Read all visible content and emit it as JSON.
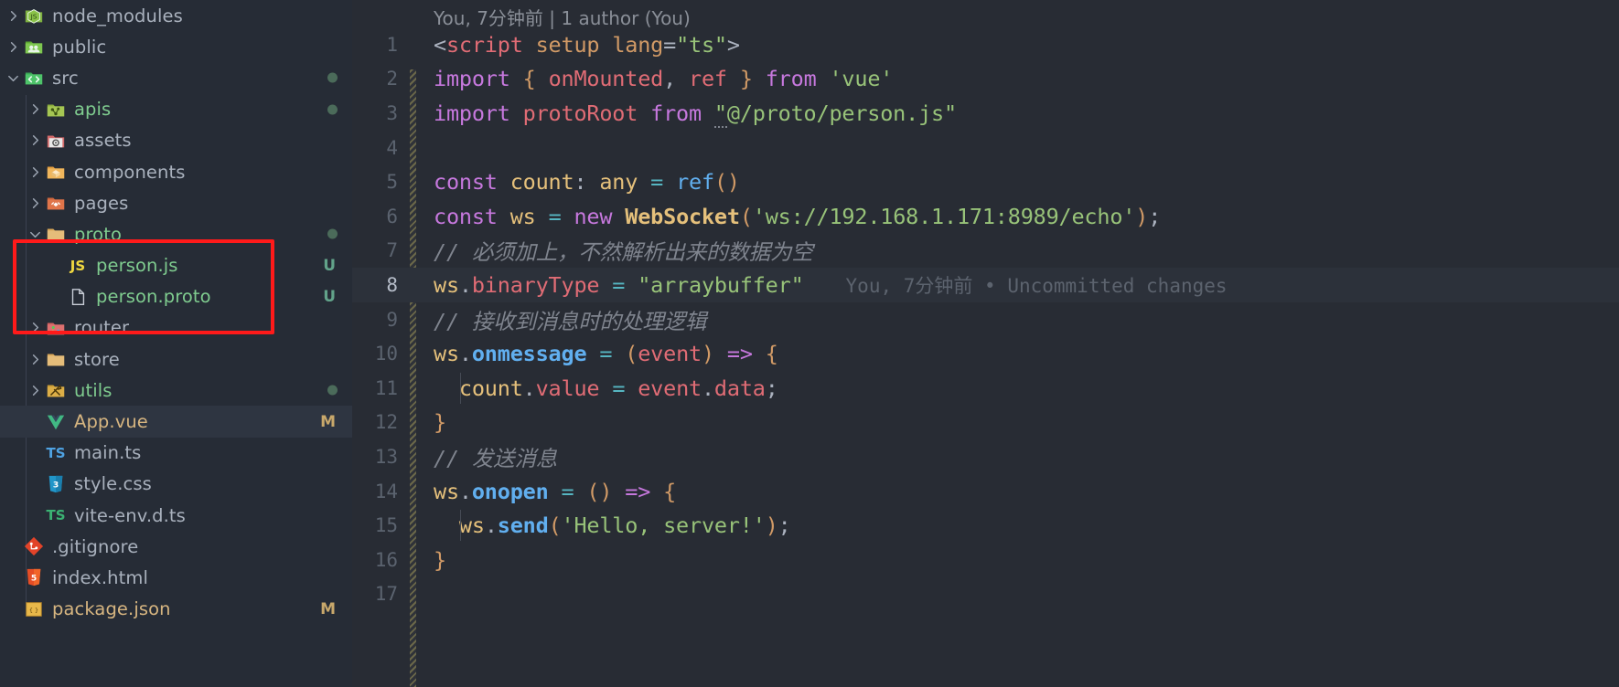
{
  "sidebar": {
    "items": [
      {
        "name": "node_modules",
        "indent": 0,
        "twisty": "chevron-right",
        "icon": "node-folder-icon",
        "color": "default",
        "badge": "",
        "dot": false
      },
      {
        "name": "public",
        "indent": 0,
        "twisty": "chevron-right",
        "icon": "public-folder-icon",
        "color": "default",
        "badge": "",
        "dot": false
      },
      {
        "name": "src",
        "indent": 0,
        "twisty": "chevron-down",
        "icon": "src-folder-icon",
        "color": "default",
        "badge": "",
        "dot": true
      },
      {
        "name": "apis",
        "indent": 1,
        "twisty": "chevron-right",
        "icon": "api-folder-icon",
        "color": "green",
        "badge": "",
        "dot": true
      },
      {
        "name": "assets",
        "indent": 1,
        "twisty": "chevron-right",
        "icon": "assets-folder-icon",
        "color": "default",
        "badge": "",
        "dot": false
      },
      {
        "name": "components",
        "indent": 1,
        "twisty": "chevron-right",
        "icon": "components-folder-icon",
        "color": "default",
        "badge": "",
        "dot": false
      },
      {
        "name": "pages",
        "indent": 1,
        "twisty": "chevron-right",
        "icon": "pages-folder-icon",
        "color": "default",
        "badge": "",
        "dot": false
      },
      {
        "name": "proto",
        "indent": 1,
        "twisty": "chevron-down",
        "icon": "folder-icon",
        "color": "green",
        "badge": "",
        "dot": true
      },
      {
        "name": "person.js",
        "indent": 2,
        "twisty": "",
        "icon": "js-file-icon",
        "color": "green",
        "badge": "U",
        "dot": false
      },
      {
        "name": "person.proto",
        "indent": 2,
        "twisty": "",
        "icon": "generic-file-icon",
        "color": "green",
        "badge": "U",
        "dot": false
      },
      {
        "name": "router",
        "indent": 1,
        "twisty": "chevron-right",
        "icon": "router-folder-icon",
        "color": "default",
        "badge": "",
        "dot": false
      },
      {
        "name": "store",
        "indent": 1,
        "twisty": "chevron-right",
        "icon": "folder-icon",
        "color": "default",
        "badge": "",
        "dot": false
      },
      {
        "name": "utils",
        "indent": 1,
        "twisty": "chevron-right",
        "icon": "utils-folder-icon",
        "color": "green",
        "badge": "",
        "dot": true
      },
      {
        "name": "App.vue",
        "indent": 1,
        "twisty": "",
        "icon": "vue-file-icon",
        "color": "modified",
        "badge": "M",
        "dot": false,
        "selected": true
      },
      {
        "name": "main.ts",
        "indent": 1,
        "twisty": "",
        "icon": "ts-file-icon",
        "color": "default",
        "badge": "",
        "dot": false
      },
      {
        "name": "style.css",
        "indent": 1,
        "twisty": "",
        "icon": "css-file-icon",
        "color": "default",
        "badge": "",
        "dot": false
      },
      {
        "name": "vite-env.d.ts",
        "indent": 1,
        "twisty": "",
        "icon": "ts-def-file-icon",
        "color": "default",
        "badge": "",
        "dot": false
      },
      {
        "name": ".gitignore",
        "indent": 0,
        "twisty": "",
        "icon": "git-file-icon",
        "color": "default",
        "badge": "",
        "dot": false
      },
      {
        "name": "index.html",
        "indent": 0,
        "twisty": "",
        "icon": "html-file-icon",
        "color": "default",
        "badge": "",
        "dot": false
      },
      {
        "name": "package.json",
        "indent": 0,
        "twisty": "",
        "icon": "json-file-icon",
        "color": "modified",
        "badge": "M",
        "dot": false
      }
    ],
    "highlight_box_color": "#ff1a1a"
  },
  "editor": {
    "blame_header": "You, 7分钟前 | 1 author (You)",
    "inline_blame": "You, 7分钟前 • Uncommitted changes",
    "active_line": 8,
    "lines": [
      {
        "n": 1,
        "text": "<script setup lang=\"ts\">"
      },
      {
        "n": 2,
        "text": "import { onMounted, ref } from 'vue'"
      },
      {
        "n": 3,
        "text": "import protoRoot from \"@/proto/person.js\""
      },
      {
        "n": 4,
        "text": ""
      },
      {
        "n": 5,
        "text": "const count: any = ref()"
      },
      {
        "n": 6,
        "text": "const ws = new WebSocket('ws://192.168.1.171:8989/echo');"
      },
      {
        "n": 7,
        "text": "// 必须加上，不然解析出来的数据为空"
      },
      {
        "n": 8,
        "text": "ws.binaryType = \"arraybuffer\""
      },
      {
        "n": 9,
        "text": "// 接收到消息时的处理逻辑"
      },
      {
        "n": 10,
        "text": "ws.onmessage = (event) => {"
      },
      {
        "n": 11,
        "text": "  count.value = event.data;"
      },
      {
        "n": 12,
        "text": "}"
      },
      {
        "n": 13,
        "text": "// 发送消息"
      },
      {
        "n": 14,
        "text": "ws.onopen = () => {"
      },
      {
        "n": 15,
        "text": "  ws.send('Hello, server!');"
      },
      {
        "n": 16,
        "text": "}"
      },
      {
        "n": 17,
        "text": ""
      }
    ]
  },
  "colors": {
    "editor_bg": "#282c34",
    "sidebar_bg": "#262c36",
    "active_line_bg": "#2c313a",
    "selection_bg": "#2e3541",
    "accent_red": "#ff1a1a"
  }
}
